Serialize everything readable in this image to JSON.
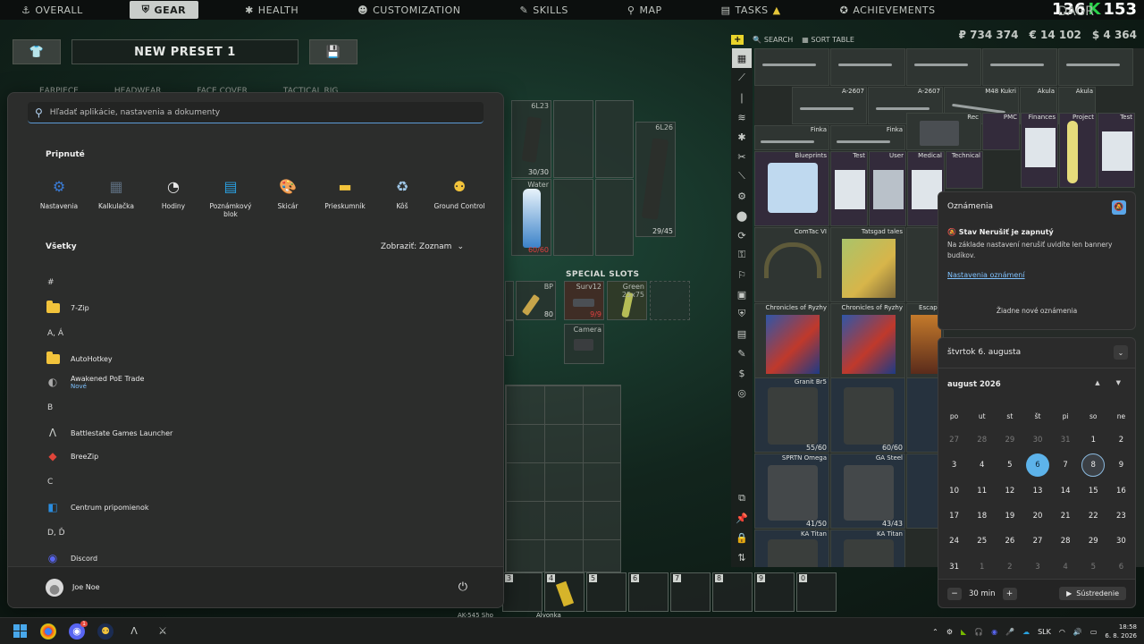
{
  "game": {
    "tabs": [
      {
        "label": "OVERALL",
        "icon": "⚓"
      },
      {
        "label": "GEAR",
        "icon": "⛨"
      },
      {
        "label": "HEALTH",
        "icon": "✱"
      },
      {
        "label": "CUSTOMIZATION",
        "icon": "☻"
      },
      {
        "label": "SKILLS",
        "icon": "✎"
      },
      {
        "label": "MAP",
        "icon": "⚲"
      },
      {
        "label": "TASKS",
        "icon": "▤"
      },
      {
        "label": "ACHIEVEMENTS",
        "icon": "✪"
      }
    ],
    "level": "136",
    "level_badge": "K",
    "level2": "153",
    "nickname_partial": "DAGR",
    "preset_name": "NEW PRESET 1",
    "slot_labels": [
      "EARPIECE",
      "HEADWEAR",
      "FACE COVER",
      "TACTICAL RIG"
    ],
    "special_slots_title": "SPECIAL SLOTS",
    "rig_cells": [
      {
        "label": "6L23",
        "count": "30/30"
      },
      {
        "label": "6L26",
        "count": "29/45"
      },
      {
        "label": "Water",
        "count": "60/60"
      }
    ],
    "special": [
      {
        "label": "BP",
        "count": "80"
      },
      {
        "label": "Surv12",
        "count": "9/9"
      },
      {
        "label": "Green",
        "count": "25x75"
      },
      {
        "label": "Camera",
        "count": ""
      }
    ],
    "quickslots": [
      "3",
      "4",
      "5",
      "6",
      "7",
      "8",
      "9",
      "0"
    ],
    "bottom_labels": [
      "AK-545 Sho",
      "Alyonka"
    ],
    "stash": {
      "search_label": "SEARCH",
      "sort_label": "SORT TABLE",
      "roubles": "₽ 734 374",
      "euros": "€ 14 102",
      "dollars": "$ 4 364",
      "items": [
        "A-2607",
        "A-2607",
        "M48 Kukri",
        "Akula",
        "Akula",
        "Finka",
        "Finka",
        "Rec",
        "PMC",
        "Finances",
        "Project",
        "Test",
        "Blueprints",
        "Test",
        "User",
        "Medical",
        "Technical",
        "ComTac VI",
        "Tatsgad tales",
        "Chronicles of Ryzhy",
        "Chronicles of Ryzhy",
        "Escape",
        "Granit Br5",
        "55/60",
        "60/60",
        "SPRTN Omega",
        "GA Steel",
        "41/50",
        "43/43",
        "KA Titan",
        "KA Titan"
      ]
    }
  },
  "start_menu": {
    "search_placeholder": "Hľadať aplikácie, nastavenia a dokumenty",
    "pinned_title": "Pripnuté",
    "pinned": [
      {
        "label": "Nastavenia",
        "icon": "gear-icon"
      },
      {
        "label": "Kalkulačka",
        "icon": "calculator-icon"
      },
      {
        "label": "Hodiny",
        "icon": "clock-icon"
      },
      {
        "label": "Poznámkový blok",
        "icon": "notepad-icon"
      },
      {
        "label": "Skicár",
        "icon": "paint-icon"
      },
      {
        "label": "Prieskumník",
        "icon": "folder-icon"
      },
      {
        "label": "Kôš",
        "icon": "recycle-bin-icon"
      },
      {
        "label": "Ground Control",
        "icon": "ground-control-icon"
      }
    ],
    "all_title": "Všetky",
    "view_label": "Zobraziť: Zoznam",
    "list": [
      {
        "type": "letter",
        "label": "#"
      },
      {
        "type": "app",
        "label": "7-Zip",
        "icon": "folder"
      },
      {
        "type": "letter",
        "label": "A, Á"
      },
      {
        "type": "app",
        "label": "AutoHotkey",
        "icon": "folder"
      },
      {
        "type": "app",
        "label": "Awakened PoE Trade",
        "sub": "Nové",
        "icon": "app"
      },
      {
        "type": "letter",
        "label": "B"
      },
      {
        "type": "app",
        "label": "Battlestate Games Launcher",
        "icon": "bsg"
      },
      {
        "type": "app",
        "label": "BreeZip",
        "icon": "breezip"
      },
      {
        "type": "letter",
        "label": "C"
      },
      {
        "type": "app",
        "label": "Centrum pripomienok",
        "icon": "feedback"
      },
      {
        "type": "letter",
        "label": "D, Ď"
      },
      {
        "type": "app",
        "label": "Discord",
        "icon": "discord"
      }
    ],
    "user_name": "Joe Noe"
  },
  "notifications": {
    "title": "Oznámenia",
    "dnd_title": "Stav Nerušiť je zapnutý",
    "dnd_text": "Na základe nastavení nerušiť uvidíte len bannery budíkov.",
    "settings_link": "Nastavenia oznámení",
    "empty_text": "Žiadne nové oznámenia"
  },
  "calendar": {
    "full_date": "štvrtok 6. augusta",
    "month_label": "august 2026",
    "weekdays": [
      "po",
      "ut",
      "st",
      "št",
      "pi",
      "so",
      "ne"
    ],
    "days": [
      [
        "27",
        "m"
      ],
      [
        "28",
        "m"
      ],
      [
        "29",
        "m"
      ],
      [
        "30",
        "m"
      ],
      [
        "31",
        "m"
      ],
      [
        "1",
        ""
      ],
      [
        "2",
        ""
      ],
      [
        "3",
        ""
      ],
      [
        "4",
        ""
      ],
      [
        "5",
        ""
      ],
      [
        "6",
        "today"
      ],
      [
        "7",
        ""
      ],
      [
        "8",
        "hover"
      ],
      [
        "9",
        ""
      ],
      [
        "10",
        ""
      ],
      [
        "11",
        ""
      ],
      [
        "12",
        ""
      ],
      [
        "13",
        ""
      ],
      [
        "14",
        ""
      ],
      [
        "15",
        ""
      ],
      [
        "16",
        ""
      ],
      [
        "17",
        ""
      ],
      [
        "18",
        ""
      ],
      [
        "19",
        ""
      ],
      [
        "20",
        ""
      ],
      [
        "21",
        ""
      ],
      [
        "22",
        ""
      ],
      [
        "23",
        ""
      ],
      [
        "24",
        ""
      ],
      [
        "25",
        ""
      ],
      [
        "26",
        ""
      ],
      [
        "27",
        ""
      ],
      [
        "28",
        ""
      ],
      [
        "29",
        ""
      ],
      [
        "30",
        ""
      ],
      [
        "31",
        ""
      ],
      [
        "1",
        "m"
      ],
      [
        "2",
        "m"
      ],
      [
        "3",
        "m"
      ],
      [
        "4",
        "m"
      ],
      [
        "5",
        "m"
      ],
      [
        "6",
        "m"
      ]
    ],
    "focus_minutes": "30 min",
    "focus_label": "Sústredenie"
  },
  "taskbar": {
    "discord_badge": "1",
    "language": "SLK",
    "time": "18:58",
    "date": "6. 8. 2026"
  }
}
